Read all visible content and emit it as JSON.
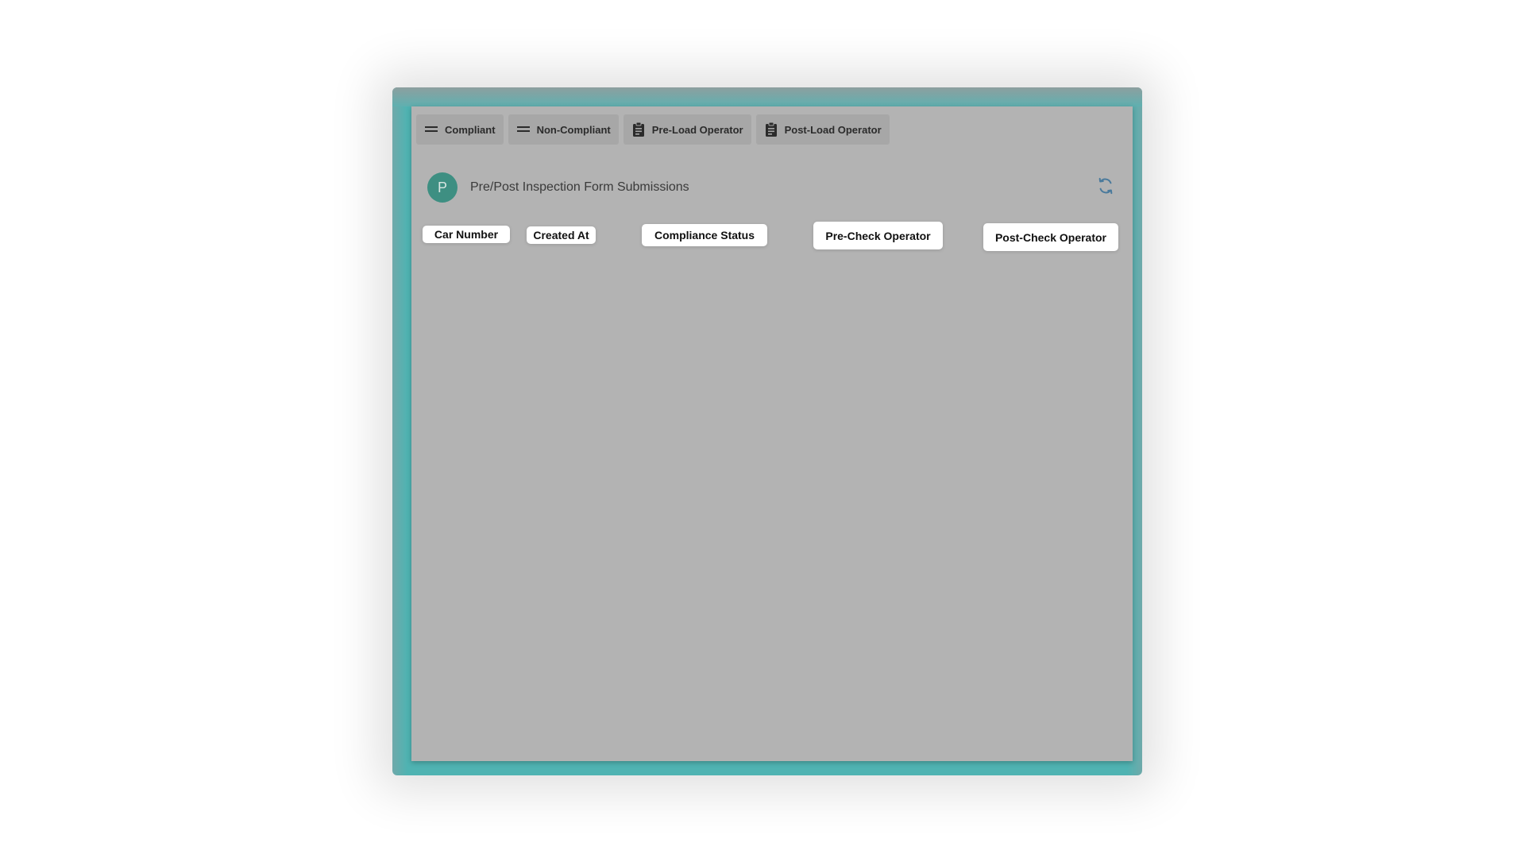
{
  "tabs": [
    {
      "label": "Compliant",
      "icon": "equals-icon"
    },
    {
      "label": "Non-Compliant",
      "icon": "equals-icon"
    },
    {
      "label": "Pre-Load Operator",
      "icon": "clipboard-icon"
    },
    {
      "label": "Post-Load Operator",
      "icon": "clipboard-icon"
    }
  ],
  "header": {
    "avatar_letter": "P",
    "title": "Pre/Post Inspection Form Submissions",
    "refresh_icon": "refresh-icon"
  },
  "table": {
    "columns": [
      "Car Number",
      "Created At",
      "Compliance Status",
      "Pre-Check Operator",
      "Post-Check Operator"
    ]
  },
  "colors": {
    "frame": "#4fb3b2",
    "panel": "#b3b3b3",
    "tab": "#a7a7a7",
    "avatar": "#3e8f82",
    "refresh": "#4a7a9c"
  }
}
